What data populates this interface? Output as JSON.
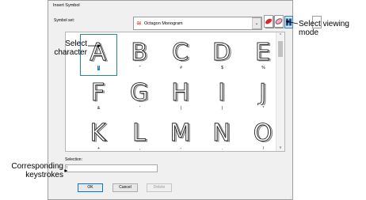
{
  "dialog": {
    "title": "Insert Symbol",
    "symbol_set_label": "Symbol set:",
    "symbol_set_value": "Octagon Monogram",
    "combo_arrow": "⌄",
    "selection_label": "Selection:",
    "selection_value": "!",
    "buttons": {
      "ok": "OK",
      "cancel": "Cancel",
      "delete": "Delete"
    }
  },
  "grid": {
    "cells": [
      {
        "glyph": "A",
        "key": "!"
      },
      {
        "glyph": "B",
        "key": "\""
      },
      {
        "glyph": "C",
        "key": "#"
      },
      {
        "glyph": "D",
        "key": "$"
      },
      {
        "glyph": "E",
        "key": "%"
      },
      {
        "glyph": "F",
        "key": "&"
      },
      {
        "glyph": "G",
        "key": "'"
      },
      {
        "glyph": "H",
        "key": "("
      },
      {
        "glyph": "I",
        "key": ")"
      },
      {
        "glyph": "J",
        "key": "*"
      },
      {
        "glyph": "K",
        "key": "+"
      },
      {
        "glyph": "L",
        "key": ","
      },
      {
        "glyph": "M",
        "key": "-"
      },
      {
        "glyph": "N",
        "key": "."
      },
      {
        "glyph": "O",
        "key": "/"
      }
    ]
  },
  "annotations": {
    "select_character": [
      "Select",
      "character"
    ],
    "select_viewing_mode": [
      "Select viewing",
      "mode"
    ],
    "corresponding_keystrokes": [
      "Corresponding",
      "keystrokes"
    ]
  },
  "colors": {
    "accent": "#1e7ed8",
    "annotation_line": "#000000",
    "symbol_icon": "#d42a2a"
  }
}
